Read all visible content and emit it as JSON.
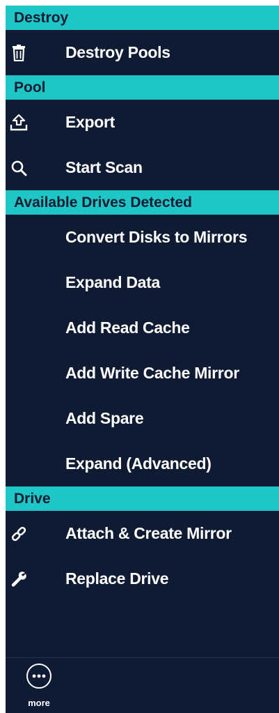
{
  "colors": {
    "panel_bg": "#0f1a33",
    "header_bg": "#1fc6c6",
    "header_text": "#0f1a33",
    "item_text": "#ffffff"
  },
  "sections": {
    "destroy": {
      "header": "Destroy",
      "items": [
        {
          "label": "Destroy Pools",
          "icon": "trash-icon"
        }
      ]
    },
    "pool": {
      "header": "Pool",
      "items": [
        {
          "label": "Export",
          "icon": "export-icon"
        },
        {
          "label": "Start Scan",
          "icon": "search-icon"
        }
      ]
    },
    "available_drives": {
      "header": "Available Drives Detected",
      "items": [
        {
          "label": "Convert Disks to Mirrors"
        },
        {
          "label": "Expand Data"
        },
        {
          "label": "Add Read Cache"
        },
        {
          "label": "Add Write Cache Mirror"
        },
        {
          "label": "Add Spare"
        },
        {
          "label": "Expand (Advanced)"
        }
      ]
    },
    "drive": {
      "header": "Drive",
      "items": [
        {
          "label": "Attach & Create Mirror",
          "icon": "link-icon"
        },
        {
          "label": "Replace Drive",
          "icon": "wrench-icon"
        }
      ]
    }
  },
  "footer": {
    "more_label": "more",
    "more_icon": "ellipsis-icon"
  }
}
